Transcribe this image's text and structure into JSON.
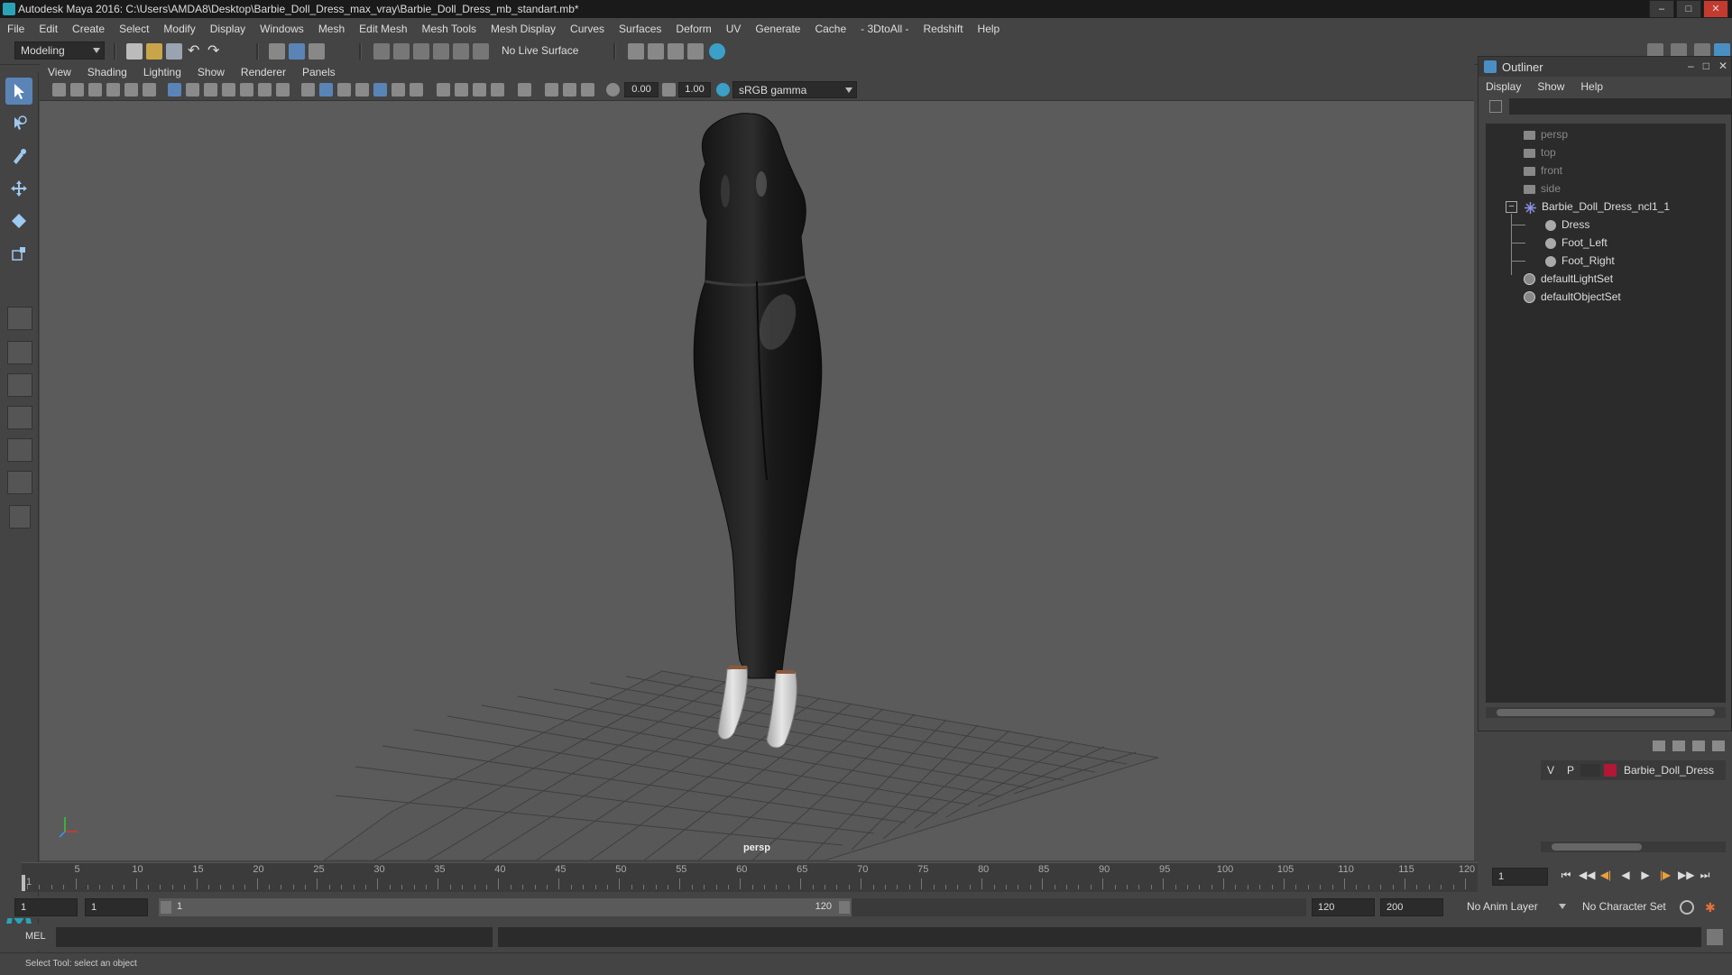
{
  "window": {
    "title": "Autodesk Maya 2016: C:\\Users\\AMDA8\\Desktop\\Barbie_Doll_Dress_max_vray\\Barbie_Doll_Dress_mb_standart.mb*"
  },
  "menubar": [
    "File",
    "Edit",
    "Create",
    "Select",
    "Modify",
    "Display",
    "Windows",
    "Mesh",
    "Edit Mesh",
    "Mesh Tools",
    "Mesh Display",
    "Curves",
    "Surfaces",
    "Deform",
    "UV",
    "Generate",
    "Cache",
    "- 3DtoAll -",
    "Redshift",
    "Help"
  ],
  "statusline": {
    "menuset": "Modeling",
    "live_surface": "No Live Surface"
  },
  "viewport": {
    "menus": [
      "View",
      "Shading",
      "Lighting",
      "Show",
      "Renderer",
      "Panels"
    ],
    "exposure": "0.00",
    "gamma": "1.00",
    "colorspace": "sRGB gamma",
    "camera": "persp"
  },
  "outliner": {
    "title": "Outliner",
    "menus": [
      "Display",
      "Show",
      "Help"
    ],
    "items": [
      {
        "label": "persp",
        "kind": "camera",
        "dim": true
      },
      {
        "label": "top",
        "kind": "camera",
        "dim": true
      },
      {
        "label": "front",
        "kind": "camera",
        "dim": true
      },
      {
        "label": "side",
        "kind": "camera",
        "dim": true
      },
      {
        "label": "Barbie_Doll_Dress_ncl1_1",
        "kind": "group",
        "dim": false
      },
      {
        "label": "Dress",
        "kind": "mesh",
        "dim": false
      },
      {
        "label": "Foot_Left",
        "kind": "mesh",
        "dim": false
      },
      {
        "label": "Foot_Right",
        "kind": "mesh",
        "dim": false
      },
      {
        "label": "defaultLightSet",
        "kind": "set",
        "dim": false
      },
      {
        "label": "defaultObjectSet",
        "kind": "set",
        "dim": false
      }
    ]
  },
  "layers": {
    "visible": "V",
    "playback": "P",
    "name": "Barbie_Doll_Dress",
    "color": "#b01836"
  },
  "timeline": {
    "ticks": [
      1,
      5,
      10,
      15,
      20,
      25,
      30,
      35,
      40,
      45,
      50,
      55,
      60,
      65,
      70,
      75,
      80,
      85,
      90,
      95,
      100,
      105,
      110,
      115,
      120
    ],
    "current_frame": "1"
  },
  "range": {
    "start": "1",
    "inner_start": "1",
    "slider_start": "1",
    "slider_end": "120",
    "end": "120",
    "max_end": "200",
    "anim_layer": "No Anim Layer",
    "character_set": "No Character Set"
  },
  "cmdline": {
    "label": "MEL"
  },
  "helpline": {
    "text": "Select Tool: select an object"
  }
}
